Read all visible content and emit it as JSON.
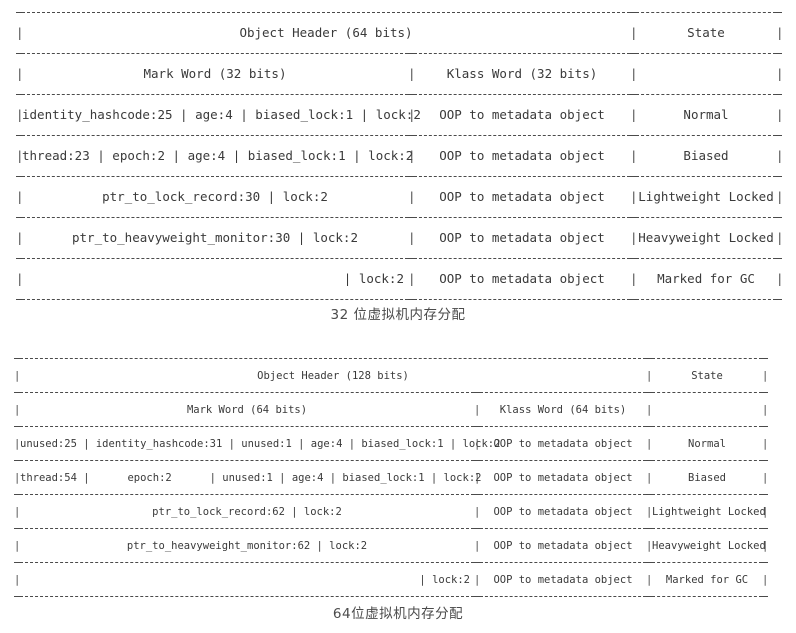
{
  "diagram": {
    "title_semantic": "java-object-header-memory-layout",
    "colors": {
      "background": "#ffffff",
      "text": "#3a3a3a",
      "rule": "#4a4a4a",
      "caption": "#4b4b4b"
    }
  },
  "table32": {
    "name": "32-bit-object-header-table",
    "caption": "32 位虚拟机内存分配",
    "header": {
      "object_header": "Object Header (64 bits)",
      "state": "State"
    },
    "subheader": {
      "mark_word": "Mark Word (32 bits)",
      "klass_word": "Klass Word (32 bits)",
      "state": ""
    },
    "rows": [
      {
        "mark_word_fields": [
          "identity_hashcode:25",
          "age:4",
          "biased_lock:1",
          "lock:2"
        ],
        "mark_word_text": "identity_hashcode:25 | age:4 | biased_lock:1 | lock:2",
        "klass_word": "OOP to metadata object",
        "state": "Normal"
      },
      {
        "mark_word_fields": [
          "thread:23",
          "epoch:2",
          "age:4",
          "biased_lock:1",
          "lock:2"
        ],
        "mark_word_text": "thread:23 | epoch:2 | age:4 | biased_lock:1 | lock:2",
        "klass_word": "OOP to metadata object",
        "state": "Biased"
      },
      {
        "mark_word_fields": [
          "ptr_to_lock_record:30",
          "lock:2"
        ],
        "mark_word_text": "ptr_to_lock_record:30 | lock:2",
        "klass_word": "OOP to metadata object",
        "state": "Lightweight Locked"
      },
      {
        "mark_word_fields": [
          "ptr_to_heavyweight_monitor:30",
          "lock:2"
        ],
        "mark_word_text": "ptr_to_heavyweight_monitor:30 | lock:2",
        "klass_word": "OOP to metadata object",
        "state": "Heavyweight Locked"
      },
      {
        "mark_word_fields": [
          "",
          "lock:2"
        ],
        "mark_word_text": "| lock:2",
        "klass_word": "OOP to metadata object",
        "state": "Marked for GC"
      }
    ]
  },
  "table64": {
    "name": "64-bit-object-header-table",
    "caption": "64位虚拟机内存分配",
    "header": {
      "object_header": "Object Header (128 bits)",
      "state": "State"
    },
    "subheader": {
      "mark_word": "Mark Word (64 bits)",
      "klass_word": "Klass Word (64 bits)",
      "state": ""
    },
    "rows": [
      {
        "mark_word_fields": [
          "unused:25",
          "identity_hashcode:31",
          "unused:1",
          "age:4",
          "biased_lock:1",
          "lock:2"
        ],
        "mark_word_text": "unused:25 | identity_hashcode:31 | unused:1 | age:4 | biased_lock:1 | lock:2",
        "klass_word": "OOP to metadata object",
        "state": "Normal"
      },
      {
        "mark_word_fields": [
          "thread:54",
          "epoch:2",
          "unused:1",
          "age:4",
          "biased_lock:1",
          "lock:2"
        ],
        "mark_word_text": "thread:54 |      epoch:2      | unused:1 | age:4 | biased_lock:1 | lock:2",
        "klass_word": "OOP to metadata object",
        "state": "Biased"
      },
      {
        "mark_word_fields": [
          "ptr_to_lock_record:62",
          "lock:2"
        ],
        "mark_word_text": "ptr_to_lock_record:62 | lock:2",
        "klass_word": "OOP to metadata object",
        "state": "Lightweight Locked"
      },
      {
        "mark_word_fields": [
          "ptr_to_heavyweight_monitor:62",
          "lock:2"
        ],
        "mark_word_text": "ptr_to_heavyweight_monitor:62 | lock:2",
        "klass_word": "OOP to metadata object",
        "state": "Heavyweight Locked"
      },
      {
        "mark_word_fields": [
          "",
          "lock:2"
        ],
        "mark_word_text": "| lock:2",
        "klass_word": "OOP to metadata object",
        "state": "Marked for GC"
      }
    ]
  },
  "glyphs": {
    "pipe": "|"
  }
}
